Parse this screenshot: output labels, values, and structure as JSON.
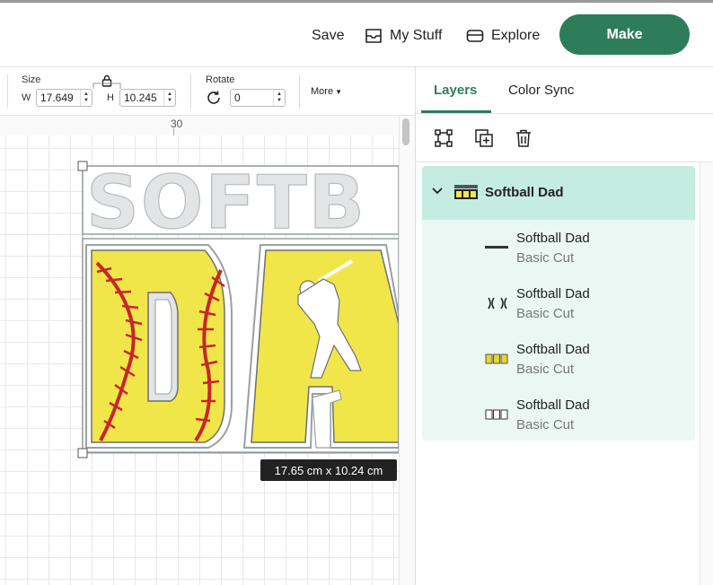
{
  "header": {
    "save": "Save",
    "my_stuff": "My Stuff",
    "explore": "Explore",
    "make": "Make"
  },
  "toolbar": {
    "size_label": "Size",
    "w_label": "W",
    "w_value": "17.649",
    "h_label": "H",
    "h_value": "10.245",
    "rotate_label": "Rotate",
    "rotate_value": "0",
    "more_label": "More"
  },
  "canvas": {
    "ruler_tick": "30",
    "dimensions": "17.65  cm x 10.24  cm",
    "design_text_top": "SOFTB",
    "design_text_bottom": "DA",
    "colors": {
      "yellow": "#f0e64a",
      "gray": "#e2e4e6",
      "stitch": "#c8262b"
    }
  },
  "panel": {
    "tabs": [
      "Layers",
      "Color Sync"
    ],
    "group": {
      "title": "Softball Dad"
    },
    "layers": [
      {
        "name": "Softball Dad",
        "op": "Basic Cut",
        "thumb": "softball-text-thumb"
      },
      {
        "name": "Softball Dad",
        "op": "Basic Cut",
        "thumb": "stitch-thumb"
      },
      {
        "name": "Softball Dad",
        "op": "Basic Cut",
        "thumb": "dad-yellow-thumb"
      },
      {
        "name": "Softball Dad",
        "op": "Basic Cut",
        "thumb": "dad-outline-thumb"
      }
    ]
  },
  "accent": "#2e7d5a"
}
